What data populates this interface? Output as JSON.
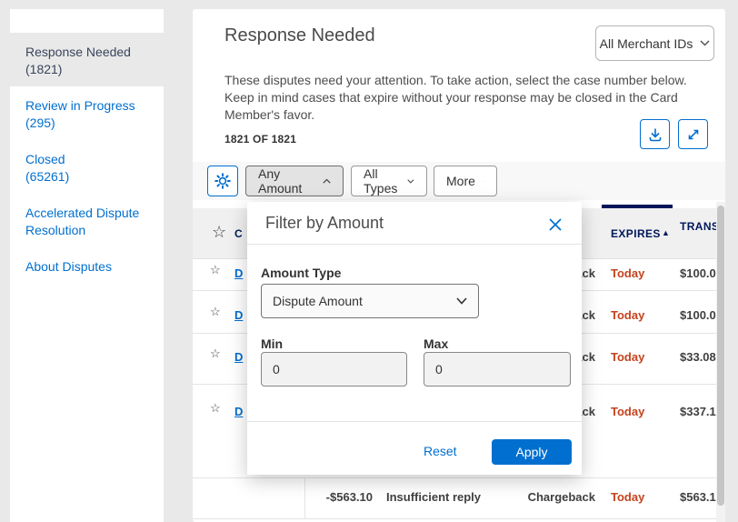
{
  "sidebar": {
    "selected": {
      "label": "Response Needed",
      "count": "(1821)"
    },
    "items": [
      {
        "label": "Review in Progress",
        "count": "(295)"
      },
      {
        "label": "Closed",
        "count": "(65261)"
      },
      {
        "label": "Accelerated Dispute Resolution",
        "count": ""
      },
      {
        "label": "About Disputes",
        "count": ""
      }
    ]
  },
  "header": {
    "title": "Response Needed",
    "merchant_filter": "All Merchant IDs",
    "description": "These disputes need your attention. To take action, select the case number below. Keep in mind cases that expire without your response may be closed in the Card Member's favor.",
    "count_label": "1821 OF 1821"
  },
  "toolbar": {
    "filters": [
      {
        "label": "Any Amount"
      },
      {
        "label": "All Types"
      },
      {
        "label": "More"
      }
    ]
  },
  "table": {
    "headers": {
      "case": "C",
      "expires": "EXPIRES",
      "trans_amount": "TRANS AMOUNT"
    },
    "sort_column": "EXPIRES",
    "rows": [
      {
        "case": "D",
        "type": "Chargeback",
        "expires": "Today",
        "trans_amount": "$100.0"
      },
      {
        "case": "D",
        "type": "Chargeback",
        "expires": "Today",
        "trans_amount": "$100.0"
      },
      {
        "case": "D",
        "type": "Chargeback",
        "expires": "Today",
        "trans_amount": "$33.08"
      },
      {
        "case": "D",
        "type": "Chargeback",
        "expires": "Today",
        "trans_amount": "$337.1"
      },
      {
        "dispute_amount": "-$563.10",
        "reason": "Insufficient reply",
        "type": "Chargeback",
        "expires": "Today",
        "trans_amount": "$563.1"
      }
    ]
  },
  "modal": {
    "title": "Filter by Amount",
    "amount_type_label": "Amount Type",
    "amount_type_value": "Dispute Amount",
    "min_label": "Min",
    "min_value": "0",
    "max_label": "Max",
    "max_value": "0",
    "reset_label": "Reset",
    "apply_label": "Apply"
  },
  "icons": {
    "star_glyph": "☆",
    "sort_up_glyph": "▲",
    "settings": "gear-icon",
    "download": "download-icon",
    "expand": "expand-icon",
    "close": "close-icon"
  },
  "colors": {
    "accent": "#006fcf",
    "navy": "#00175a",
    "alert": "#c5421d"
  }
}
